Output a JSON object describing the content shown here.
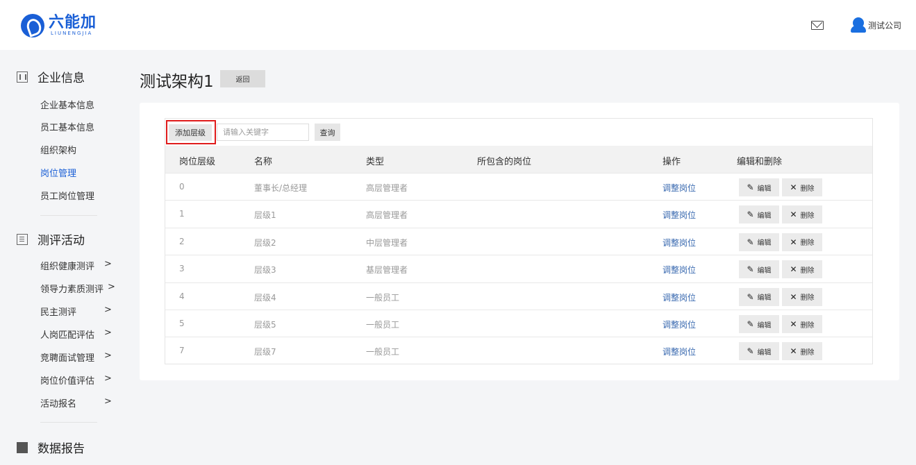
{
  "header": {
    "logo_cn": "六能加",
    "logo_en": "LIUNENGJIA",
    "company": "测试公司"
  },
  "sidebar": {
    "sections": [
      {
        "label": "企业信息",
        "icon": "building-icon"
      },
      {
        "label": "测评活动",
        "icon": "clipboard-icon"
      },
      {
        "label": "数据报告",
        "icon": "file-icon"
      }
    ],
    "company_items": [
      "企业基本信息",
      "员工基本信息",
      "组织架构",
      "岗位管理",
      "员工岗位管理"
    ],
    "activity_items": [
      "组织健康测评",
      "领导力素质测评",
      "民主测评",
      "人岗匹配评估",
      "竞聘面试管理",
      "岗位价值评估",
      "活动报名"
    ],
    "arrow": ">"
  },
  "page": {
    "title": "测试架构1",
    "back_label": "返回"
  },
  "toolbar": {
    "add_label": "添加层级",
    "search_placeholder": "请输入关键字",
    "query_label": "查询"
  },
  "table": {
    "headers": [
      "岗位层级",
      "名称",
      "类型",
      "所包含的岗位",
      "操作",
      "编辑和删除"
    ],
    "action_label": "调整岗位",
    "edit_label": "编辑",
    "delete_label": "删除",
    "rows": [
      {
        "level": "0",
        "name": "董事长/总经理",
        "type": "高层管理者",
        "positions": ""
      },
      {
        "level": "1",
        "name": "层级1",
        "type": "高层管理者",
        "positions": ""
      },
      {
        "level": "2",
        "name": "层级2",
        "type": "中层管理者",
        "positions": ""
      },
      {
        "level": "3",
        "name": "层级3",
        "type": "基层管理者",
        "positions": ""
      },
      {
        "level": "4",
        "name": "层级4",
        "type": "一般员工",
        "positions": ""
      },
      {
        "level": "5",
        "name": "层级5",
        "type": "一般员工",
        "positions": ""
      },
      {
        "level": "7",
        "name": "层级7",
        "type": "一般员工",
        "positions": ""
      }
    ]
  },
  "colors": {
    "brand": "#1a5fd6",
    "active_nav": "#1a5fd6",
    "link": "#3a6ab0",
    "highlight": "#e01b1b"
  }
}
